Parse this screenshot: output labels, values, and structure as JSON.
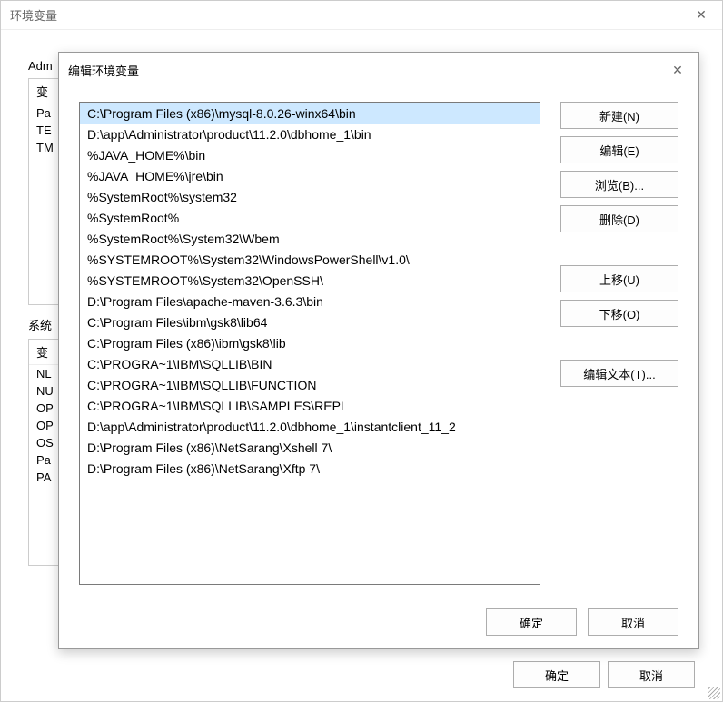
{
  "parentWindow": {
    "title": "环境变量",
    "userSectionLabel": "Adm",
    "userVarHeader": "变",
    "userVarRows": [
      "Pa",
      "TE",
      "TM"
    ],
    "sysSectionLabel": "系统",
    "sysVarHeader": "变",
    "sysVarRows": [
      "NL",
      "NU",
      "OP",
      "OP",
      "OS",
      "Pa",
      "PA"
    ],
    "okLabel": "确定",
    "cancelLabel": "取消"
  },
  "editDialog": {
    "title": "编辑环境变量",
    "paths": [
      "C:\\Program Files (x86)\\mysql-8.0.26-winx64\\bin",
      "D:\\app\\Administrator\\product\\11.2.0\\dbhome_1\\bin",
      "%JAVA_HOME%\\bin",
      "%JAVA_HOME%\\jre\\bin",
      "%SystemRoot%\\system32",
      "%SystemRoot%",
      "%SystemRoot%\\System32\\Wbem",
      "%SYSTEMROOT%\\System32\\WindowsPowerShell\\v1.0\\",
      "%SYSTEMROOT%\\System32\\OpenSSH\\",
      "D:\\Program Files\\apache-maven-3.6.3\\bin",
      "C:\\Program Files\\ibm\\gsk8\\lib64",
      "C:\\Program Files (x86)\\ibm\\gsk8\\lib",
      "C:\\PROGRA~1\\IBM\\SQLLIB\\BIN",
      "C:\\PROGRA~1\\IBM\\SQLLIB\\FUNCTION",
      "C:\\PROGRA~1\\IBM\\SQLLIB\\SAMPLES\\REPL",
      "D:\\app\\Administrator\\product\\11.2.0\\dbhome_1\\instantclient_11_2",
      "D:\\Program Files (x86)\\NetSarang\\Xshell 7\\",
      "D:\\Program Files (x86)\\NetSarang\\Xftp 7\\"
    ],
    "selectedIndex": 0,
    "buttons": {
      "new": "新建(N)",
      "edit": "编辑(E)",
      "browse": "浏览(B)...",
      "delete": "删除(D)",
      "moveUp": "上移(U)",
      "moveDown": "下移(O)",
      "editText": "编辑文本(T)..."
    },
    "okLabel": "确定",
    "cancelLabel": "取消"
  }
}
